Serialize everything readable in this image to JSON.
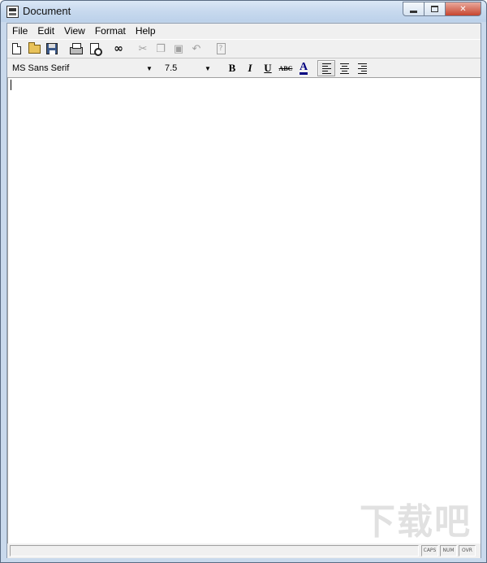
{
  "window": {
    "title": "Document",
    "close_glyph": "✕"
  },
  "menubar": {
    "items": [
      {
        "label": "File"
      },
      {
        "label": "Edit"
      },
      {
        "label": "View"
      },
      {
        "label": "Format"
      },
      {
        "label": "Help"
      }
    ]
  },
  "toolbar": {
    "icons": [
      "new-document-icon",
      "open-folder-icon",
      "save-icon",
      "print-icon",
      "print-preview-icon",
      "find-icon",
      "cut-icon",
      "copy-icon",
      "paste-icon",
      "undo-icon",
      "help-icon"
    ],
    "find_glyph": "∞",
    "cut_glyph": "✂",
    "copy_glyph": "❐",
    "paste_glyph": "▣",
    "undo_glyph": "↶",
    "help_glyph": "?"
  },
  "format_bar": {
    "font_name": "MS Sans Serif",
    "font_size": "7.5",
    "dropdown_glyph": "▼",
    "bold_label": "B",
    "italic_label": "I",
    "underline_label": "U",
    "strike_label": "ABC",
    "color_label": "A",
    "text_color": "#000080",
    "alignment_selected": "left"
  },
  "status": {
    "caps": "CAPS",
    "num": "NUM",
    "ovr": "OVR"
  },
  "watermark": "下载吧"
}
